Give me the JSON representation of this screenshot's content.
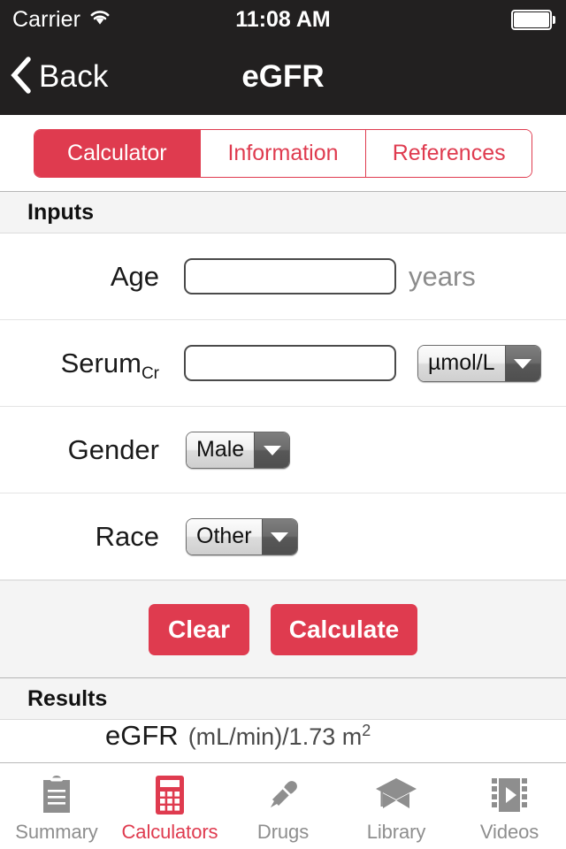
{
  "status_bar": {
    "carrier": "Carrier",
    "wifi_icon": "wifi-icon",
    "time": "11:08 AM",
    "battery_icon": "battery-icon"
  },
  "nav_bar": {
    "back_label": "Back",
    "back_icon": "chevron-left-icon",
    "title": "eGFR"
  },
  "segmented_control": {
    "tabs": [
      {
        "label": "Calculator",
        "active": true
      },
      {
        "label": "Information",
        "active": false
      },
      {
        "label": "References",
        "active": false
      }
    ]
  },
  "sections": {
    "inputs_header": "Inputs",
    "results_header": "Results"
  },
  "form": {
    "rows": [
      {
        "label": "Age",
        "label_sub": "",
        "value": "",
        "placeholder": "",
        "unit_suffix": "years"
      },
      {
        "label": "Serum",
        "label_sub": "Cr",
        "value": "",
        "placeholder": "",
        "unit_select": "µmol/L"
      },
      {
        "label": "Gender",
        "select_value": "Male"
      },
      {
        "label": "Race",
        "select_value": "Other"
      }
    ]
  },
  "actions": {
    "clear_label": "Clear",
    "calculate_label": "Calculate",
    "accent_color": "#DF3B4F"
  },
  "results": {
    "rows": [
      {
        "name": "eGFR",
        "units_prefix": "(mL/min)/1.73 m",
        "units_exp": "2"
      }
    ]
  },
  "tab_bar": {
    "items": [
      {
        "label": "Summary",
        "icon": "clipboard-icon",
        "active": false
      },
      {
        "label": "Calculators",
        "icon": "calculator-icon",
        "active": true
      },
      {
        "label": "Drugs",
        "icon": "pipette-icon",
        "active": false
      },
      {
        "label": "Library",
        "icon": "graduation-cap-icon",
        "active": false
      },
      {
        "label": "Videos",
        "icon": "film-play-icon",
        "active": false
      }
    ]
  }
}
